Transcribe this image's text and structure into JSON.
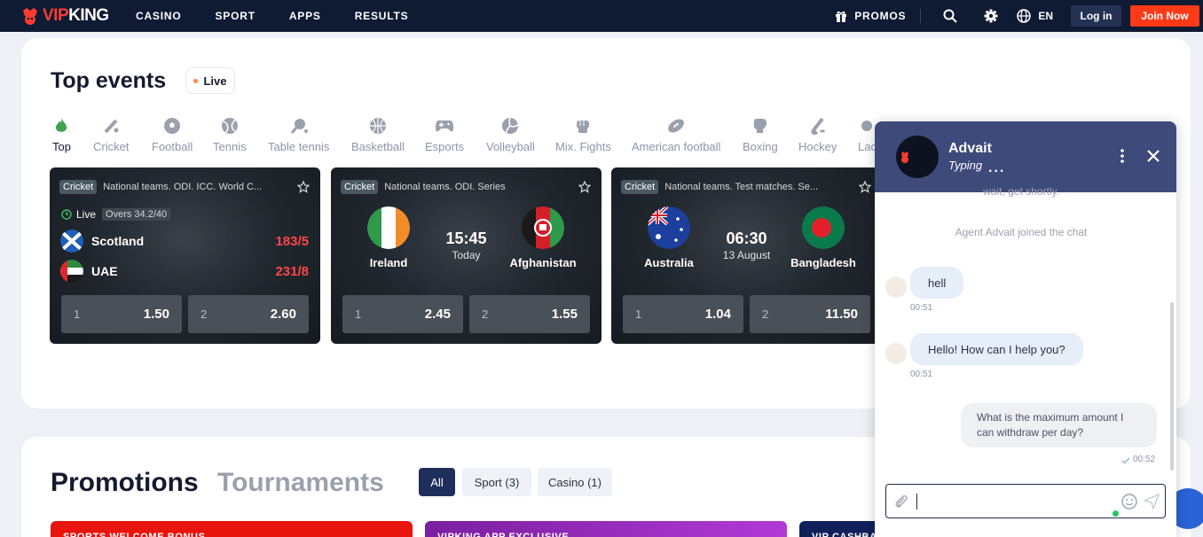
{
  "nav": {
    "logo_vip": "VIP",
    "logo_king": "KING",
    "links": [
      "CASINO",
      "SPORT",
      "APPS",
      "RESULTS"
    ],
    "promos": "PROMOS",
    "lang": "EN",
    "login": "Log in",
    "join": "Join Now"
  },
  "top_events": {
    "title": "Top events",
    "live_label": "Live",
    "sports": [
      "Top",
      "Cricket",
      "Football",
      "Tennis",
      "Table tennis",
      "Basketball",
      "Esports",
      "Volleyball",
      "Mix. Fights",
      "American football",
      "Boxing",
      "Hockey",
      "Lac"
    ],
    "matches": [
      {
        "tag": "Cricket",
        "league": "National teams. ODI. ICC. World C...",
        "live": "Live",
        "overs": "Overs 34.2/40",
        "team1": "Scotland",
        "score1": "183/5",
        "team2": "UAE",
        "score2": "231/8",
        "odd1_label": "1",
        "odd1": "1.50",
        "odd2_label": "2",
        "odd2": "2.60"
      },
      {
        "tag": "Cricket",
        "league": "National teams. ODI. Series",
        "team1": "Ireland",
        "team2": "Afghanistan",
        "time": "15:45",
        "date": "Today",
        "odd1_label": "1",
        "odd1": "2.45",
        "odd2_label": "2",
        "odd2": "1.55"
      },
      {
        "tag": "Cricket",
        "league": "National teams. Test matches. Se...",
        "team1": "Australia",
        "team2": "Bangladesh",
        "time": "06:30",
        "date": "13 August",
        "odd1_label": "1",
        "odd1": "1.04",
        "odd2_label": "2",
        "odd2": "11.50"
      }
    ]
  },
  "promotions": {
    "title": "Promotions",
    "tournaments": "Tournaments",
    "filters": [
      "All",
      "Sport (3)",
      "Casino (1)"
    ],
    "banners": [
      "SPORTS WELCOME BONUS",
      "VIPKING APP EXCLUSIVE",
      "VIP CASHBACK"
    ]
  },
  "chat": {
    "agent_name": "Advait",
    "status": "Typing",
    "status_dots": "...",
    "clipped_text": "wait, get shortly.",
    "system_msg": "Agent Advait joined the chat",
    "msg1": "hell",
    "msg1_time": "00:51",
    "msg2": "Hello! How can I help you?",
    "msg2_time": "00:51",
    "msg3": "What is the maximum amount I can withdraw per day?",
    "msg3_time": "00:52",
    "input_value": ""
  },
  "colors": {
    "nav_bg": "#0f1a33",
    "accent_red": "#ff3a17",
    "chat_header": "#3e4a7a",
    "score_red": "#ff4747"
  }
}
